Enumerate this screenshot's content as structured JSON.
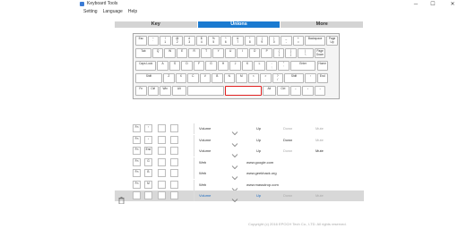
{
  "window": {
    "title": "Keyboard Tools",
    "minimize": "─",
    "maximize": "☐",
    "close": "✕"
  },
  "menu": [
    "Setting",
    "Language",
    "Help"
  ],
  "tabs": [
    "Key",
    "Unions",
    "More"
  ],
  "keyboard": {
    "row1": [
      "Esc",
      "~\n`",
      "!\n1",
      "@\n2",
      "#\n3",
      "$\n4",
      "%\n5",
      "^\n6",
      "&\n7",
      "*\n8",
      "(\n9",
      ")\n0",
      "_\n-",
      "+\n=",
      "Backspace",
      "Page\nUp"
    ],
    "row2": [
      "Tab",
      "Q",
      "W",
      "E",
      "R",
      "T",
      "Y",
      "U",
      "I",
      "O",
      "P",
      "{\n[",
      "}\n]",
      "|\n\\",
      "Page\nDown"
    ],
    "row3": [
      "Caps Lock",
      "A",
      "S",
      "D",
      "F",
      "G",
      "H",
      "J",
      "K",
      "L",
      ":\n;",
      "\"\n'",
      "Enter",
      "Home"
    ],
    "row4": [
      "Shift",
      "Z",
      "X",
      "C",
      "V",
      "B",
      "N",
      "M",
      "<\n,",
      ">\n.",
      "?\n/",
      "Shift",
      "↑",
      "End"
    ],
    "row5": [
      "Fn",
      "Ctrl",
      "Win",
      "Alt",
      "",
      "",
      "Alt",
      "Ctrl",
      "←",
      "↓",
      "→"
    ]
  },
  "unions": [
    {
      "keys": [
        "Fn",
        "↑"
      ],
      "action": "Volume",
      "value": "Up",
      "opt1": "Down",
      "opt2": "Mute"
    },
    {
      "keys": [
        "Fn",
        "↓"
      ],
      "action": "Volume",
      "value": "Up",
      "opt1": "Down",
      "opt2": "Mute"
    },
    {
      "keys": [
        "Fn",
        "End"
      ],
      "action": "Volume",
      "value": "Up",
      "opt1": "Down",
      "opt2": "Mute"
    },
    {
      "keys": [
        "Fn",
        "G"
      ],
      "action": "Web",
      "value": "www.google.com",
      "opt1": "",
      "opt2": ""
    },
    {
      "keys": [
        "Fn",
        "B"
      ],
      "action": "Web",
      "value": "www.geekhack.org",
      "opt1": "",
      "opt2": ""
    },
    {
      "keys": [
        "Fn",
        "M"
      ],
      "action": "Web",
      "value": "www.massdrop.com",
      "opt1": "",
      "opt2": ""
    },
    {
      "keys": [
        "",
        ""
      ],
      "action": "Volume",
      "value": "Up",
      "opt1": "Down",
      "opt2": "Mute"
    }
  ],
  "copyright": "Copyright (c) 2016 EPOCH Tech Co., LTD. All rights reserved."
}
